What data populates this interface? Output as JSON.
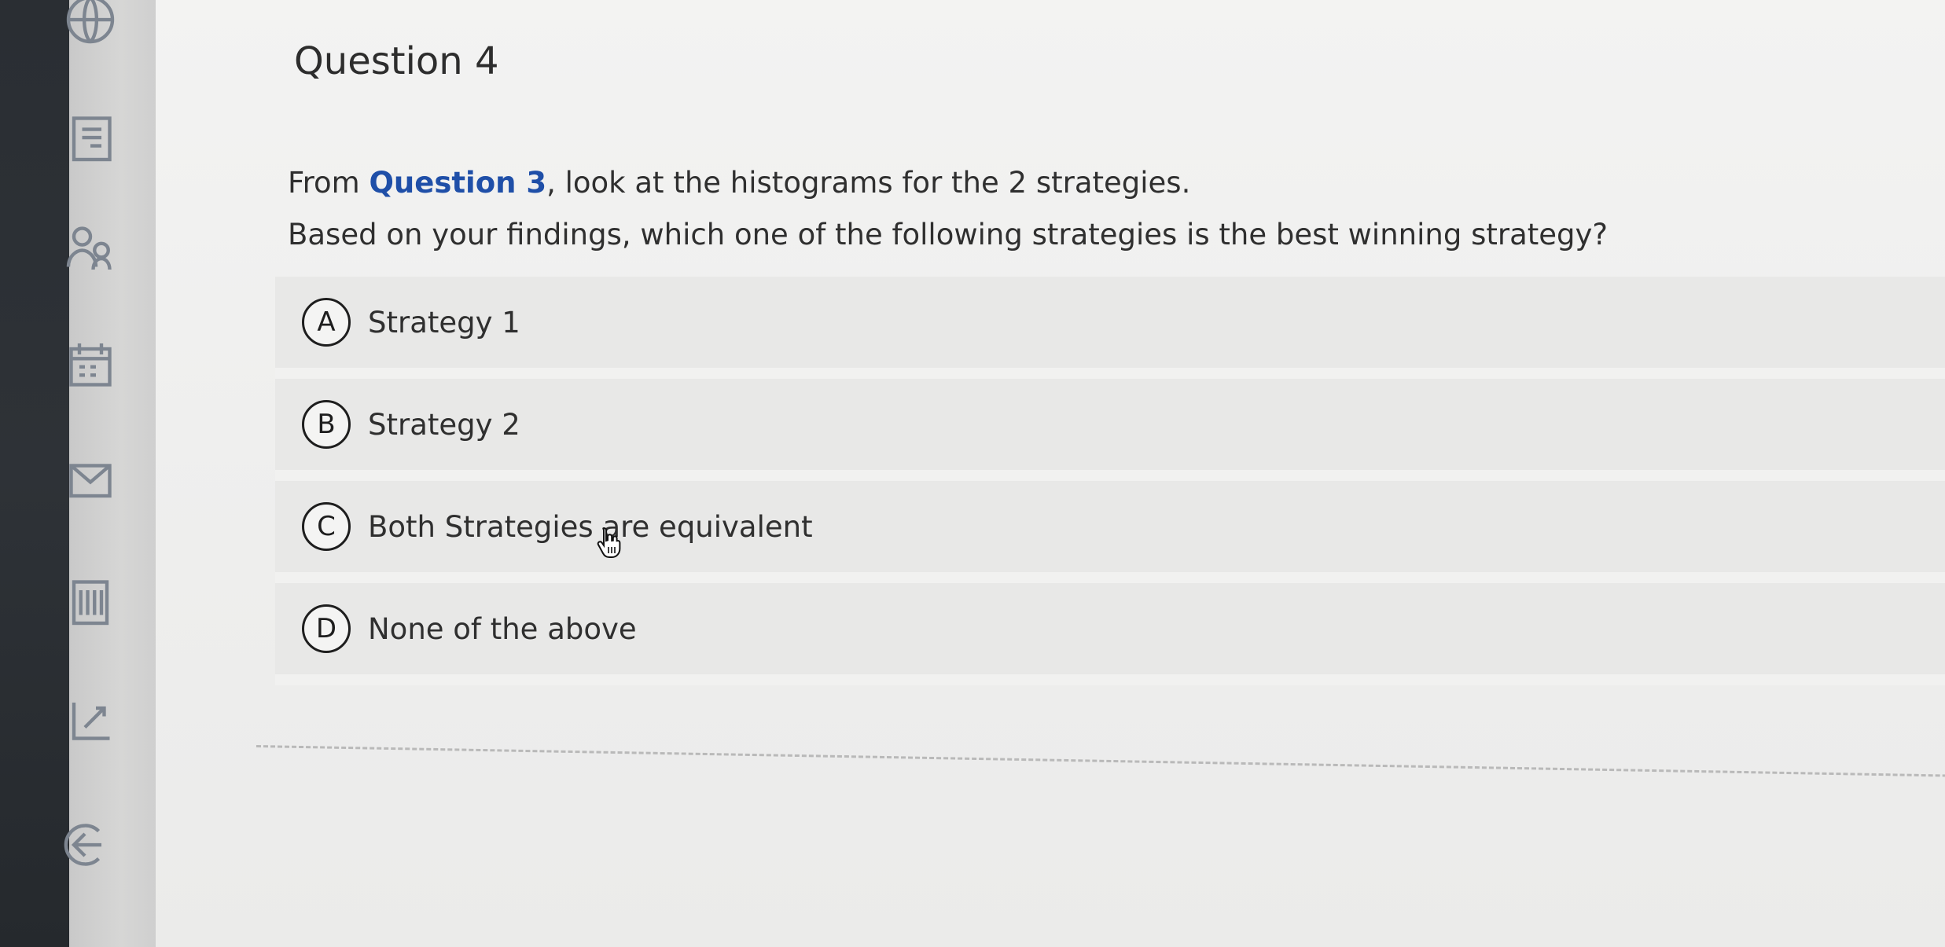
{
  "question": {
    "title": "Question 4",
    "prompt_intro": "From ",
    "prompt_ref": "Question 3",
    "prompt_rest": ", look at the histograms for the 2 strategies.",
    "prompt_line2": "Based on your findings, which one of the following strategies is the best winning strategy?"
  },
  "options": [
    {
      "letter": "A",
      "label": "Strategy 1"
    },
    {
      "letter": "B",
      "label": "Strategy 2"
    },
    {
      "letter": "C",
      "label": "Both Strategies are equivalent"
    },
    {
      "letter": "D",
      "label": "None of the above"
    }
  ],
  "sidebar": {
    "icons": [
      "globe-icon",
      "document-icon",
      "people-icon",
      "calendar-icon",
      "mail-icon",
      "list-icon",
      "edit-icon",
      "logout-icon"
    ]
  },
  "colors": {
    "link": "#1f4fa8",
    "rail": "#2a2e33"
  }
}
